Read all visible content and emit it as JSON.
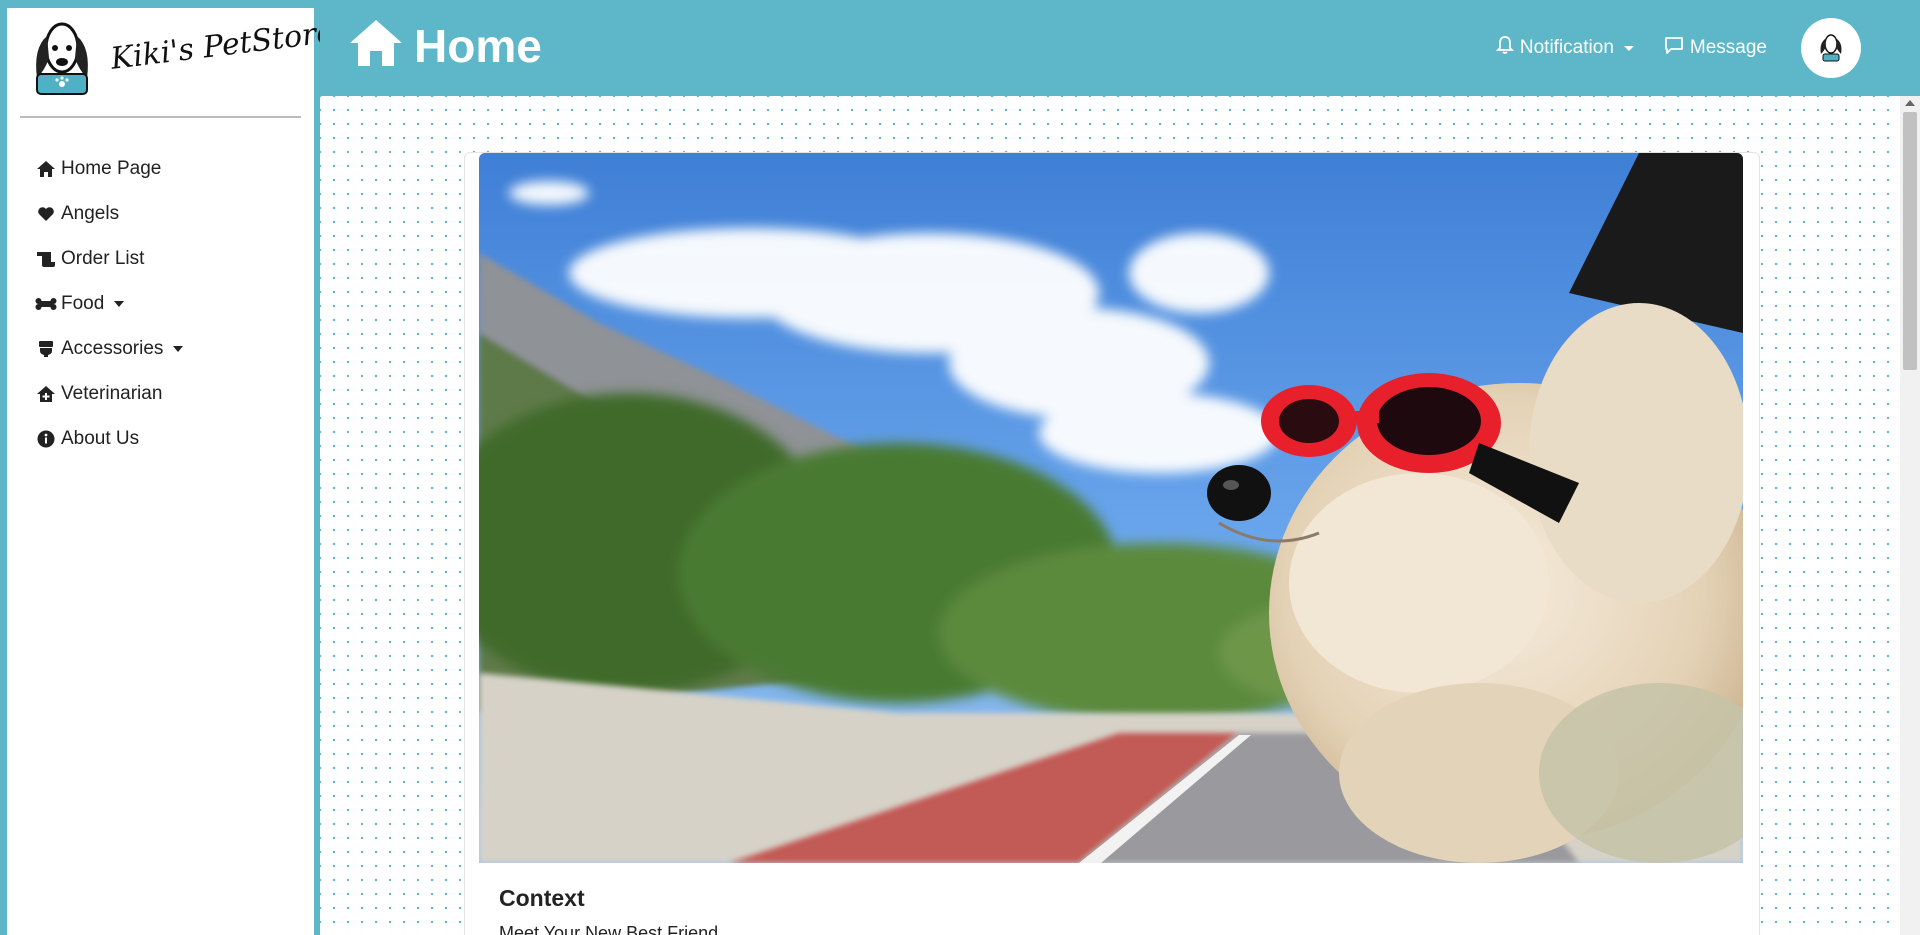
{
  "brand": {
    "name": "Kiki's PetStore"
  },
  "sidebar": {
    "items": [
      {
        "label": "Home Page",
        "icon": "home-icon"
      },
      {
        "label": "Angels",
        "icon": "heart-icon"
      },
      {
        "label": "Order List",
        "icon": "scroll-icon"
      },
      {
        "label": "Food",
        "icon": "bone-icon",
        "dropdown": true
      },
      {
        "label": "Accessories",
        "icon": "toilet-icon",
        "dropdown": true
      },
      {
        "label": "Veterinarian",
        "icon": "house-medical-icon"
      },
      {
        "label": "About Us",
        "icon": "info-icon"
      }
    ]
  },
  "header": {
    "title": "Home",
    "notification_label": "Notification",
    "message_label": "Message"
  },
  "card": {
    "title": "Context",
    "subtitle": "Meet Your New Best Friend"
  },
  "colors": {
    "accent": "#5eb7c8",
    "goggles": "#e8202c",
    "sky": "#4a8fe0"
  }
}
